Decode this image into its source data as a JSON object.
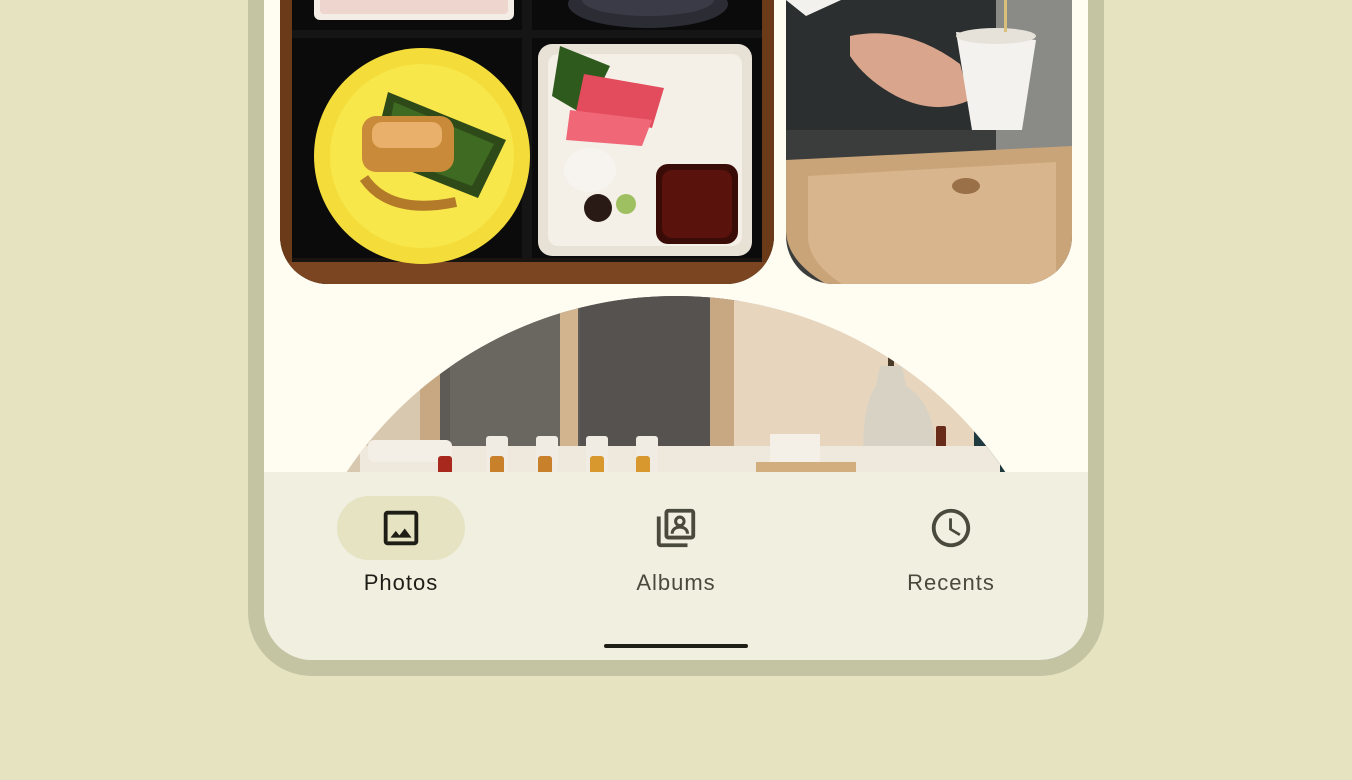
{
  "navigation": {
    "items": [
      {
        "label": "Photos",
        "icon": "image-icon",
        "selected": true
      },
      {
        "label": "Albums",
        "icon": "photo-library-icon",
        "selected": false
      },
      {
        "label": "Recents",
        "icon": "clock-icon",
        "selected": false
      }
    ]
  },
  "photos": [
    {
      "subject": "bento-box"
    },
    {
      "subject": "tea-pouring"
    },
    {
      "subject": "shop-display"
    }
  ],
  "colors": {
    "background": "#e5e3c0",
    "device_frame": "#c4c4a2",
    "screen": "#fffcf2",
    "nav_bar": "#f0efe0",
    "active_indicator": "#e5e3c1",
    "icon_active": "#1e1e16",
    "icon_inactive": "#4a4a3c"
  }
}
